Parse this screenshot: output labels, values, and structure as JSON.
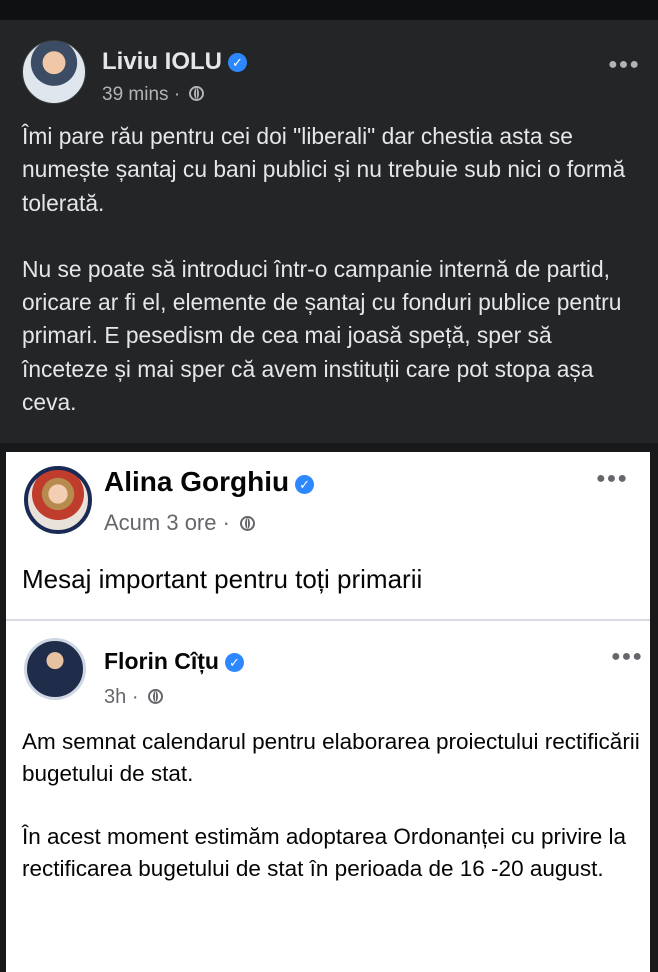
{
  "post": {
    "author": "Liviu IOLU",
    "time": "39 mins",
    "separator": "·",
    "paragraphs": [
      "Îmi pare rău pentru cei doi \"liberali\" dar chestia asta se numește șantaj cu bani publici și nu trebuie sub nici o formă tolerată.",
      "Nu se poate să introduci într-o campanie internă de partid, oricare ar fi el, elemente de șantaj cu fonduri publice pentru primari. E pesedism de cea mai joasă speță, sper să înceteze și mai sper că avem instituții care pot stopa așa ceva."
    ]
  },
  "shared": {
    "author": "Alina Gorghiu",
    "time": "Acum 3 ore",
    "separator": "·",
    "text": "Mesaj important pentru toți primarii"
  },
  "inner": {
    "author": "Florin Cîțu",
    "time": "3h",
    "separator": "·",
    "paragraphs": [
      "Am semnat calendarul pentru elaborarea proiectului rectificării bugetului de stat.",
      "În acest moment estimăm adoptarea Ordonanței cu privire la rectificarea bugetului de stat în perioada de 16 -20 august."
    ]
  },
  "icons": {
    "verified": "verified-badge-icon",
    "privacy": "globe-icon",
    "more": "more-options-icon"
  },
  "colors": {
    "dark_bg": "#242526",
    "verified_blue": "#2d88ff",
    "shared_ring": "#1a2a55"
  }
}
